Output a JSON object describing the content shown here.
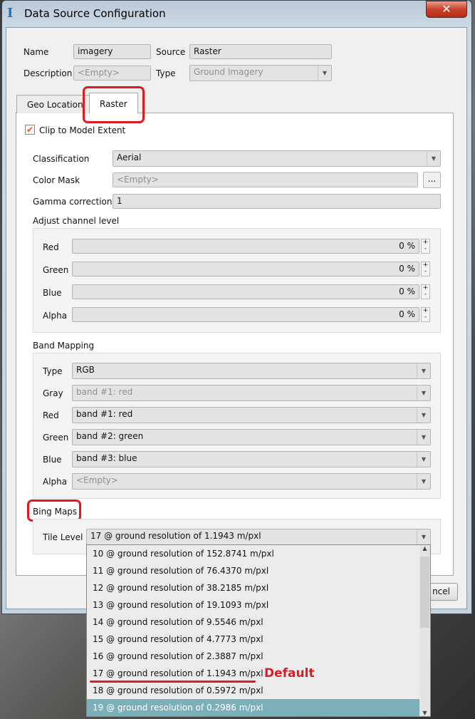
{
  "window": {
    "title": "Data Source Configuration",
    "close_glyph": "✕",
    "icon_glyph": "I"
  },
  "header": {
    "name_label": "Name",
    "name_value": "imagery",
    "source_label": "Source",
    "source_value": "Raster",
    "description_label": "Description",
    "description_placeholder": "<Empty>",
    "type_label": "Type",
    "type_value": "Ground Imagery"
  },
  "tabs": [
    {
      "label": "Geo Location",
      "active": false
    },
    {
      "label": "Raster",
      "active": true
    }
  ],
  "raster": {
    "clip_label": "Clip to Model Extent",
    "clip_checked": true,
    "classification_label": "Classification",
    "classification_value": "Aerial",
    "color_mask_label": "Color Mask",
    "color_mask_placeholder": "<Empty>",
    "browse_label": "...",
    "gamma_label": "Gamma correction",
    "gamma_value": "1",
    "adjust_title": "Adjust channel level",
    "channels": [
      {
        "label": "Red",
        "value": "0 %"
      },
      {
        "label": "Green",
        "value": "0 %"
      },
      {
        "label": "Blue",
        "value": "0 %"
      },
      {
        "label": "Alpha",
        "value": "0 %"
      }
    ],
    "band_title": "Band Mapping",
    "bands": [
      {
        "label": "Type",
        "value": "RGB",
        "disabled": false
      },
      {
        "label": "Gray",
        "value": "band #1: red",
        "disabled": true
      },
      {
        "label": "Red",
        "value": "band #1: red",
        "disabled": false
      },
      {
        "label": "Green",
        "value": "band #2: green",
        "disabled": false
      },
      {
        "label": "Blue",
        "value": "band #3: blue",
        "disabled": false
      },
      {
        "label": "Alpha",
        "value": "<Empty>",
        "disabled": true
      }
    ],
    "bing_title": "Bing Maps",
    "tile_label": "Tile Level",
    "tile_value": "17 @ ground resolution of 1.1943 m/pxl"
  },
  "dropdown": {
    "items": [
      "10 @ ground resolution of 152.8741 m/pxl",
      "11 @ ground resolution of 76.4370 m/pxl",
      "12 @ ground resolution of 38.2185 m/pxl",
      "13 @ ground resolution of 19.1093 m/pxl",
      "14 @ ground resolution of 9.5546 m/pxl",
      "15 @ ground resolution of 4.7773 m/pxl",
      "16 @ ground resolution of 2.3887 m/pxl",
      "17 @ ground resolution of 1.1943 m/pxl",
      "18 @ ground resolution of 0.5972 m/pxl",
      "19 @ ground resolution of 0.2986 m/pxl"
    ],
    "selected_index": 9
  },
  "footer": {
    "cancel_label": "ncel"
  },
  "annotation": {
    "default_label": "Default",
    "color": "#e01a22"
  },
  "colors": {
    "selection": "#7bb0bb",
    "checkbox": "#e05a1a"
  }
}
